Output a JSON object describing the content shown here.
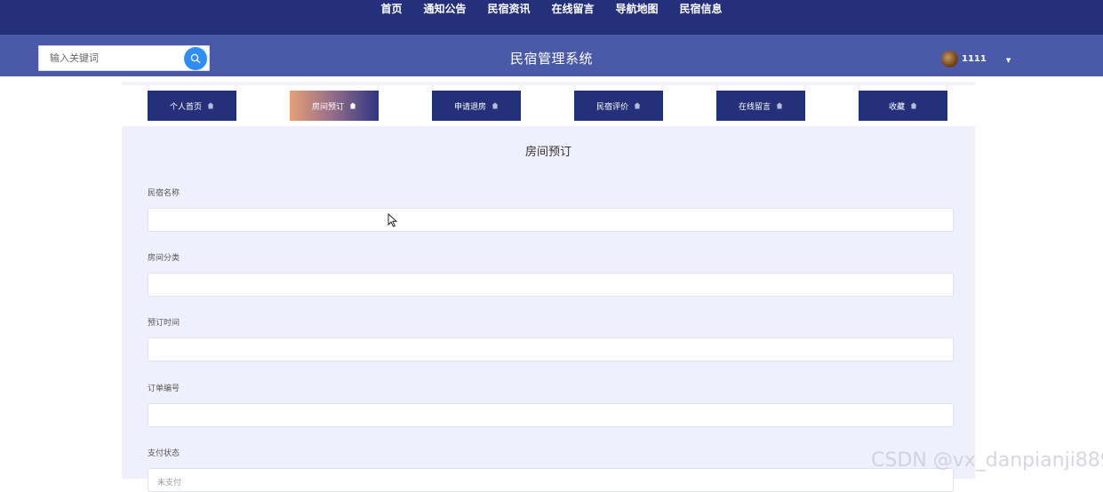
{
  "topnav": {
    "items": [
      "首页",
      "通知公告",
      "民宿资讯",
      "在线留言",
      "导航地图",
      "民宿信息"
    ]
  },
  "header": {
    "search_placeholder": "输入关键词",
    "title": "民宿管理系统",
    "username": "1111"
  },
  "tabs": [
    {
      "label": "个人首页",
      "active": false
    },
    {
      "label": "房间预订",
      "active": true
    },
    {
      "label": "申请退房",
      "active": false
    },
    {
      "label": "民宿评价",
      "active": false
    },
    {
      "label": "在线留言",
      "active": false
    },
    {
      "label": "收藏",
      "active": false
    }
  ],
  "form": {
    "title": "房间预订",
    "fields": [
      {
        "label": "民宿名称",
        "value": ""
      },
      {
        "label": "房间分类",
        "value": ""
      },
      {
        "label": "预订时间",
        "value": ""
      },
      {
        "label": "订单编号",
        "value": ""
      },
      {
        "label": "支付状态",
        "value": "未支付"
      }
    ]
  },
  "watermark": "CSDN @vx_danpianji889",
  "colors": {
    "topnav_bg": "#243079",
    "header_bg": "#4a5aa8",
    "search_button": "#2e8ef5",
    "tab_bg": "#243079",
    "content_bg": "#f0f0fd"
  }
}
